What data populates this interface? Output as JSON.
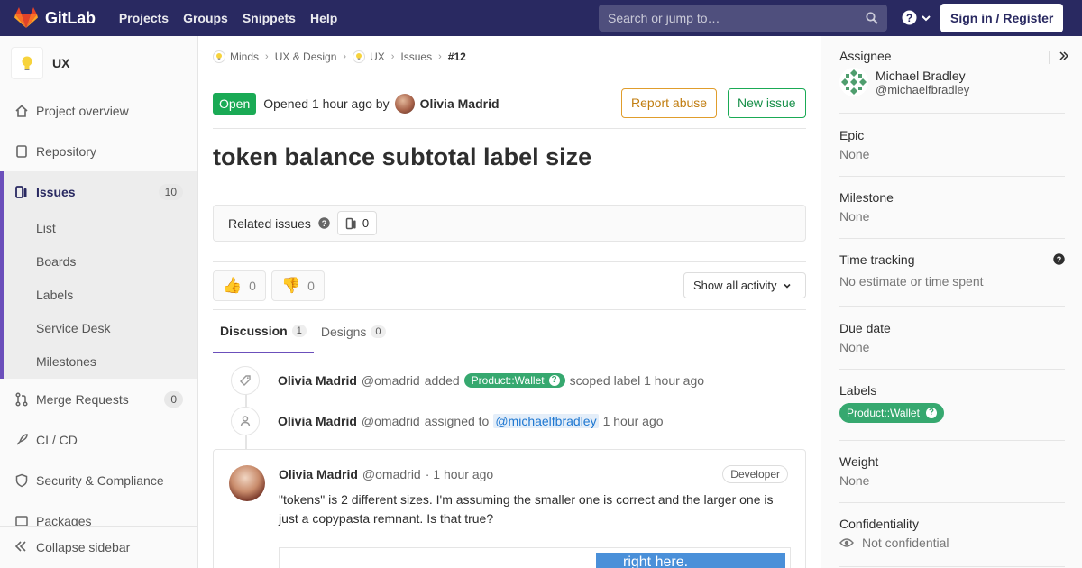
{
  "topbar": {
    "brand": "GitLab",
    "nav": [
      "Projects",
      "Groups",
      "Snippets",
      "Help"
    ],
    "search_placeholder": "Search or jump to…",
    "signin_label": "Sign in / Register",
    "bg_color": "#292961"
  },
  "sidebar": {
    "project_name": "UX",
    "items": [
      {
        "label": "Project overview",
        "icon": "home-icon"
      },
      {
        "label": "Repository",
        "icon": "doc-icon"
      },
      {
        "label": "Issues",
        "icon": "issues-icon",
        "count": "10",
        "active": true
      },
      {
        "label": "Merge Requests",
        "icon": "merge-request-icon",
        "count": "0"
      },
      {
        "label": "CI / CD",
        "icon": "rocket-icon"
      },
      {
        "label": "Security & Compliance",
        "icon": "shield-icon"
      },
      {
        "label": "Packages",
        "icon": "package-icon"
      }
    ],
    "sub_items": [
      "List",
      "Boards",
      "Labels",
      "Service Desk",
      "Milestones"
    ],
    "collapse_label": "Collapse sidebar"
  },
  "breadcrumb": [
    "Minds",
    "UX & Design",
    "UX",
    "Issues",
    "#12"
  ],
  "issue": {
    "status": "Open",
    "opened_text": "Opened 1 hour ago by",
    "author": "Olivia Madrid",
    "report_abuse": "Report abuse",
    "new_issue": "New issue",
    "title": "token balance subtotal label size",
    "related_label": "Related issues",
    "related_count": "0",
    "thumbs_up": "0",
    "thumbs_down": "0",
    "activity_filter": "Show all activity"
  },
  "tabs": [
    {
      "label": "Discussion",
      "count": "1"
    },
    {
      "label": "Designs",
      "count": "0"
    }
  ],
  "notes": [
    {
      "author": "Olivia Madrid",
      "handle": "@omadrid",
      "pre": "added",
      "label": "Product::Wallet",
      "post": "scoped label 1 hour ago"
    },
    {
      "author": "Olivia Madrid",
      "handle": "@omadrid",
      "pre": "assigned to",
      "mention": "@michaelfbradley",
      "post": "1 hour ago"
    }
  ],
  "comment": {
    "author": "Olivia Madrid",
    "handle": "@omadrid",
    "time": "· 1 hour ago",
    "role": "Developer",
    "body": "\"tokens\" is 2 different sizes. I'm assuming the smaller one is correct and the larger one is just a copypasta remnant. Is that true?",
    "image_text": "right here."
  },
  "right_sidebar": {
    "assignee": {
      "header": "Assignee",
      "name": "Michael Bradley",
      "username": "@michaelfbradley"
    },
    "epic": {
      "header": "Epic",
      "value": "None"
    },
    "milestone": {
      "header": "Milestone",
      "value": "None"
    },
    "time_tracking": {
      "header": "Time tracking",
      "value": "No estimate or time spent"
    },
    "due_date": {
      "header": "Due date",
      "value": "None"
    },
    "labels": {
      "header": "Labels",
      "value": "Product::Wallet"
    },
    "weight": {
      "header": "Weight",
      "value": "None"
    },
    "confidentiality": {
      "header": "Confidentiality",
      "value": "Not confidential"
    }
  },
  "colors": {
    "accent": "#6b4fbb",
    "success": "#1aaa55",
    "label_green": "#36a86f",
    "warning": "#e09d2c",
    "link": "#1f78d1"
  }
}
